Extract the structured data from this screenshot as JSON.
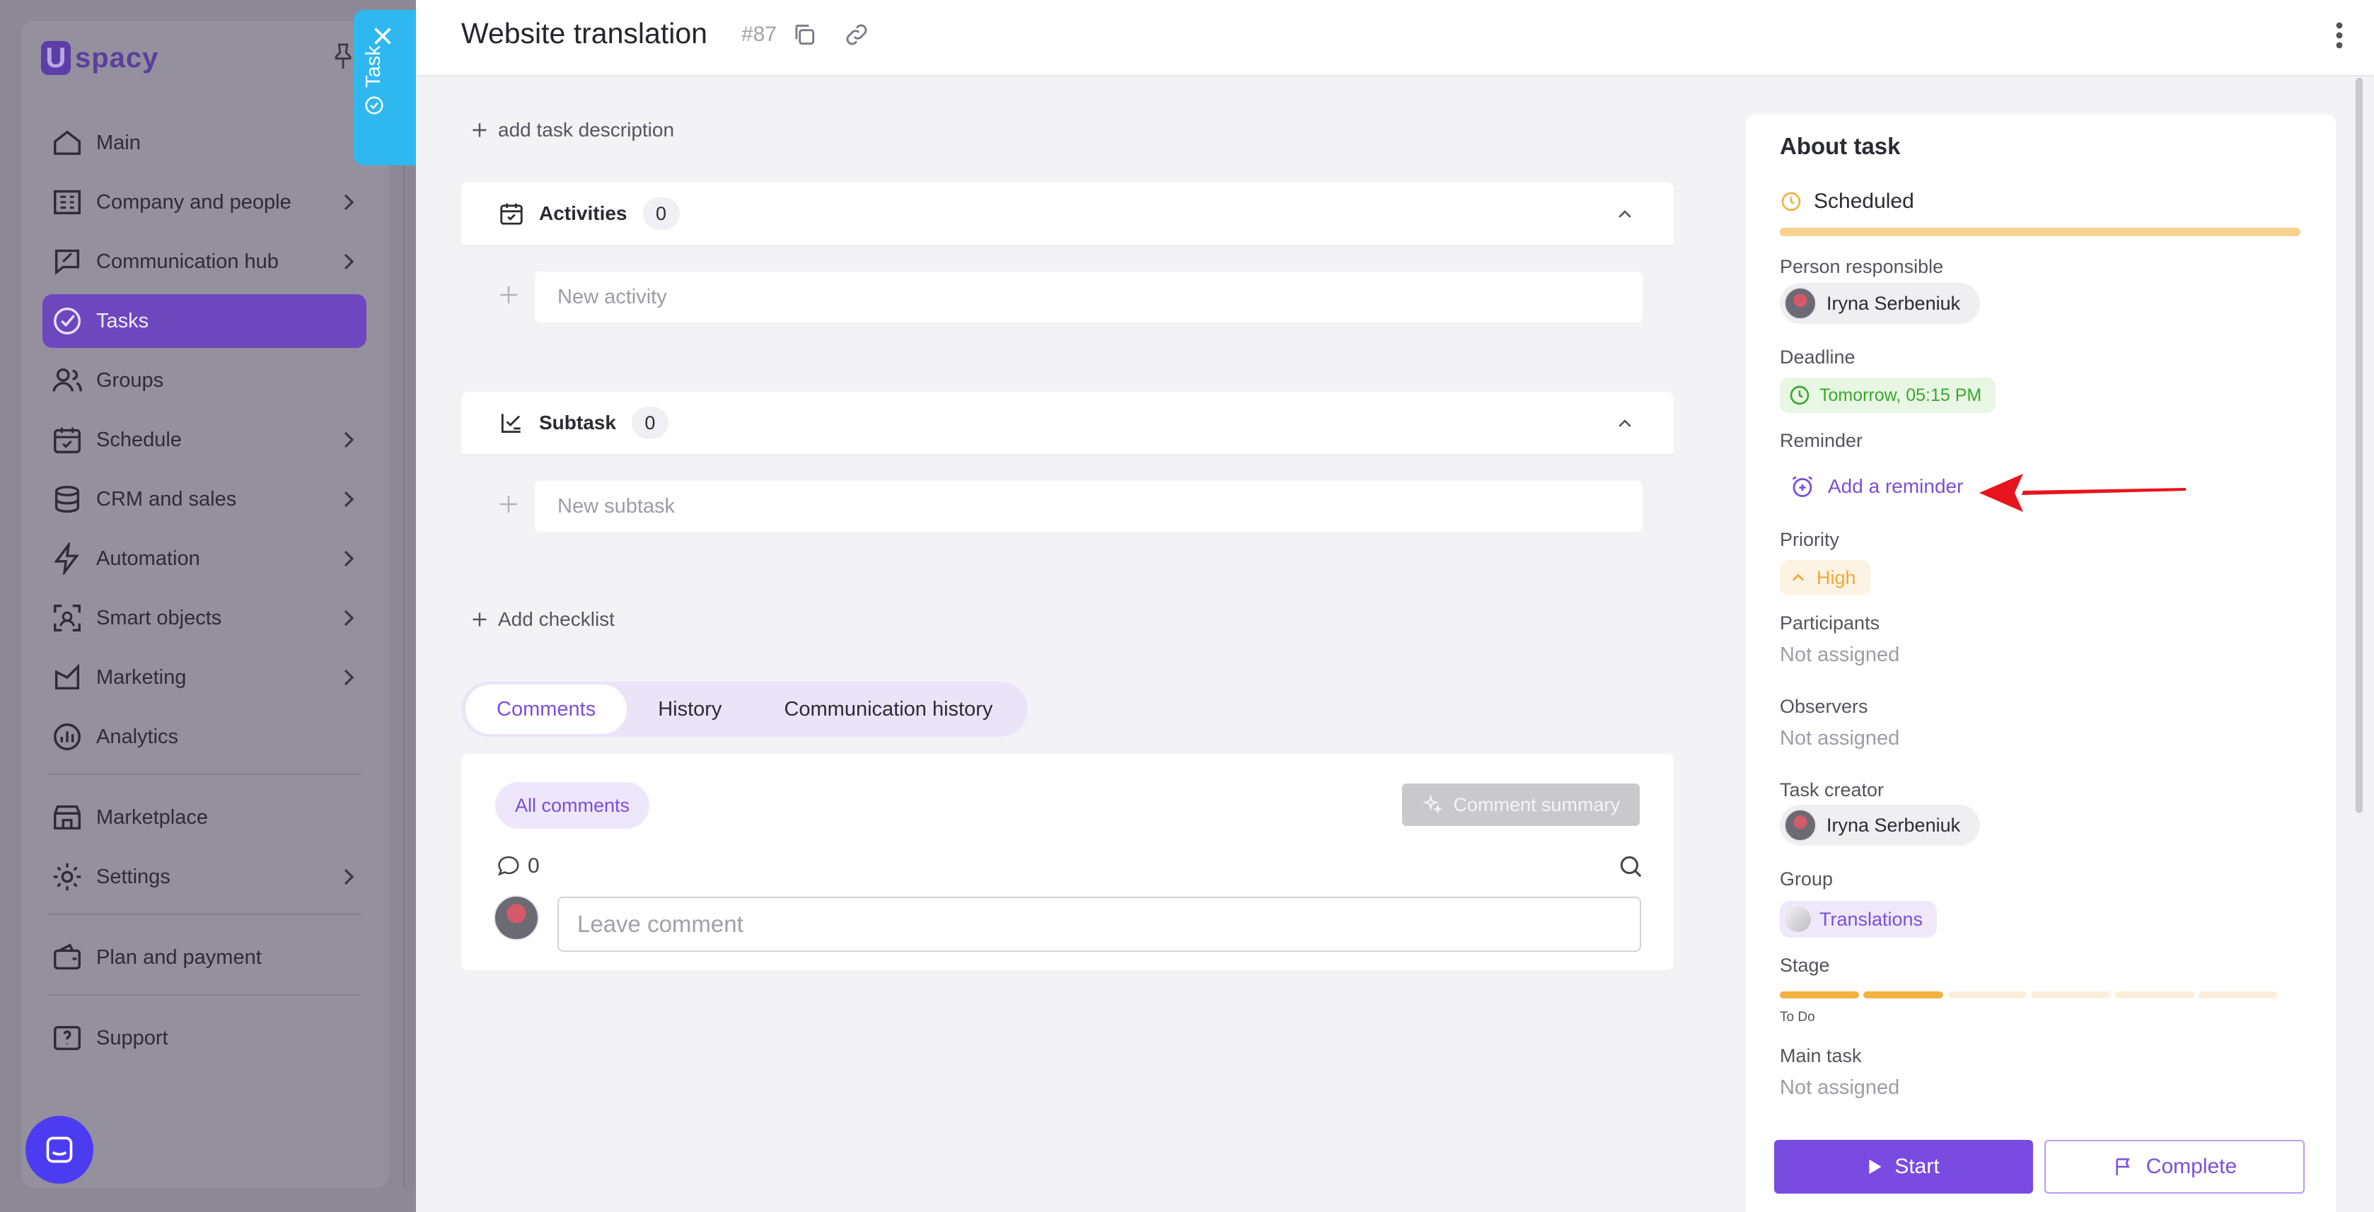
{
  "app": {
    "logo_letter": "U",
    "logo_text": "spacy"
  },
  "sidebar": {
    "items": [
      {
        "label": "Main",
        "icon": "home-icon"
      },
      {
        "label": "Company and people",
        "icon": "company-icon",
        "has_submenu": true
      },
      {
        "label": "Communication hub",
        "icon": "communication-icon",
        "has_submenu": true
      },
      {
        "label": "Tasks",
        "icon": "tasks-icon",
        "active": true
      },
      {
        "label": "Groups",
        "icon": "groups-icon"
      },
      {
        "label": "Schedule",
        "icon": "calendar-icon",
        "has_submenu": true
      },
      {
        "label": "CRM and sales",
        "icon": "crm-icon",
        "has_submenu": true
      },
      {
        "label": "Automation",
        "icon": "lightning-icon",
        "has_submenu": true
      },
      {
        "label": "Smart objects",
        "icon": "smart-objects-icon",
        "has_submenu": true
      },
      {
        "label": "Marketing",
        "icon": "marketing-icon",
        "has_submenu": true
      },
      {
        "label": "Analytics",
        "icon": "analytics-icon"
      },
      {
        "label": "Marketplace",
        "icon": "marketplace-icon"
      },
      {
        "label": "Settings",
        "icon": "gear-icon",
        "has_submenu": true
      },
      {
        "label": "Plan and payment",
        "icon": "wallet-icon"
      },
      {
        "label": "Support",
        "icon": "support-icon"
      }
    ]
  },
  "task_tab": {
    "label": "Task"
  },
  "task": {
    "title": "Website translation",
    "id": "#87",
    "add_description": "add task description",
    "activities": {
      "label": "Activities",
      "count": "0",
      "new_placeholder": "New activity"
    },
    "subtask": {
      "label": "Subtask",
      "count": "0",
      "new_placeholder": "New subtask"
    },
    "add_checklist": "Add checklist",
    "tabs": [
      "Comments",
      "History",
      "Communication history"
    ],
    "comments": {
      "filter": "All comments",
      "summary_button": "Comment summary",
      "count": "0",
      "placeholder": "Leave comment"
    }
  },
  "about": {
    "title": "About task",
    "status": "Scheduled",
    "person_responsible_label": "Person responsible",
    "person_responsible": "Iryna Serbeniuk",
    "deadline_label": "Deadline",
    "deadline": "Tomorrow, 05:15 PM",
    "reminder_label": "Reminder",
    "reminder_action": "Add a reminder",
    "priority_label": "Priority",
    "priority": "High",
    "participants_label": "Participants",
    "participants": "Not assigned",
    "observers_label": "Observers",
    "observers": "Not assigned",
    "creator_label": "Task creator",
    "creator": "Iryna Serbeniuk",
    "group_label": "Group",
    "group": "Translations",
    "stage_label": "Stage",
    "stage": "To Do",
    "stage_progress": {
      "completed_segments": 2,
      "total_segments": 6
    },
    "main_task_label": "Main task",
    "main_task": "Not assigned"
  },
  "actions": {
    "start": "Start",
    "complete": "Complete"
  },
  "colors": {
    "accent": "#7a4be0",
    "task_tab": "#2fb8ef",
    "status_scheduled": "#f2b23f",
    "deadline_green": "#3aa82c",
    "priority_high": "#efa83a",
    "annotation_arrow": "#e8141c"
  }
}
